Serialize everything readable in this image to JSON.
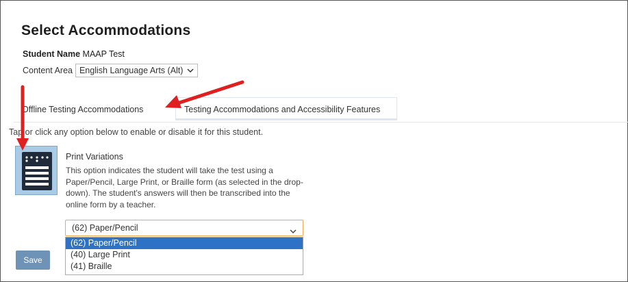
{
  "page": {
    "title": "Select Accommodations",
    "student_label": "Student Name",
    "student_name": "MAAP Test",
    "content_area_label": "Content Area",
    "content_area_value": "English Language Arts (Alt)"
  },
  "tabs": [
    {
      "label": "Offline Testing Accommodations"
    },
    {
      "label": "Testing Accommodations and Accessibility Features"
    }
  ],
  "instruction": "Tap or click any option below to enable or disable it for this student.",
  "accommodation": {
    "icon": "braille-document-icon",
    "title": "Print Variations",
    "description": "This option indicates the student will take the test using a Paper/Pencil, Large Print, or Braille form (as selected in the drop-down). The student's answers will then be transcribed into the online form by a teacher.",
    "selected_value": "(62) Paper/Pencil",
    "options": [
      "(62) Paper/Pencil",
      "(40) Large Print",
      "(41) Braille"
    ]
  },
  "actions": {
    "save_label": "Save"
  },
  "colors": {
    "annotation_arrow": "#e02020",
    "dropdown_focus": "#f0a84a",
    "option_highlight": "#2e72c5",
    "save_button": "#6f93b6",
    "tile": "#a9cbe6"
  }
}
